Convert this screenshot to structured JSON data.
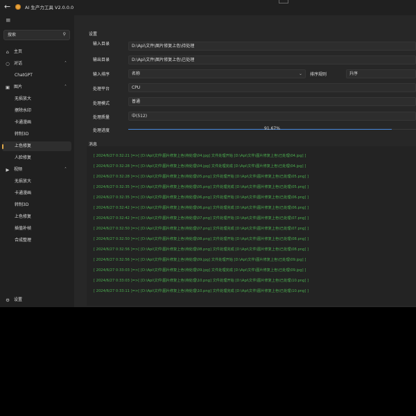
{
  "titlebar": {
    "back_icon": "back-arrow-icon",
    "title": "AI 生产力工具 V2.0.0.0"
  },
  "sidebar": {
    "menu_icon": "hamburger-icon",
    "search": {
      "placeholder": "搜索",
      "icon": "search-icon"
    },
    "items": [
      {
        "label": "主页",
        "icon": "home-icon"
      },
      {
        "label": "对话",
        "icon": "chat-icon",
        "expandable": true
      },
      {
        "label": "ChatGPT",
        "sub": true
      },
      {
        "label": "图片",
        "icon": "image-icon",
        "expandable": true
      },
      {
        "label": "无损放大",
        "sub": true
      },
      {
        "label": "擦除水印",
        "sub": true
      },
      {
        "label": "卡通漫画",
        "sub": true
      },
      {
        "label": "转制3D",
        "sub": true
      },
      {
        "label": "上色修复",
        "sub": true,
        "active": true
      },
      {
        "label": "人脸修复",
        "sub": true
      },
      {
        "label": "视频",
        "icon": "video-icon",
        "expandable": true
      },
      {
        "label": "无损放大",
        "sub": true
      },
      {
        "label": "卡通漫画",
        "sub": true
      },
      {
        "label": "转制3D",
        "sub": true
      },
      {
        "label": "上色修复",
        "sub": true
      },
      {
        "label": "插值补帧",
        "sub": true
      },
      {
        "label": "合成整理",
        "sub": true
      }
    ],
    "settings": {
      "label": "设置",
      "icon": "gear-icon"
    }
  },
  "settings_section": {
    "title": "设置",
    "input_dir": {
      "label": "输入目录",
      "value": "D:\\Api\\文件\\图片修复上色\\待处理"
    },
    "output_dir": {
      "label": "输出目录",
      "value": "D:\\Api\\文件\\图片修复上色\\已处理"
    },
    "sort": {
      "label": "输入排序",
      "value": "名称",
      "rule_label": "排序规则",
      "rule_value": "升序"
    },
    "platform": {
      "label": "处理平台",
      "value": "CPU"
    },
    "mode": {
      "label": "处理模式",
      "value": "普通"
    },
    "size": {
      "label": "处理质量",
      "value": "中(512)"
    },
    "progress": {
      "label": "处理进度",
      "value": 0.9167,
      "text": "91.67%"
    }
  },
  "messages": {
    "title": "消息",
    "color": "#4caf50",
    "lines": [
      "[ 2024/6/27 0:32:21 ]=>[ [D:\\Api\\文件\\图片修复上色\\待处理\\04.jpg] 文件处理开始 [D:\\Api\\文件\\图片修复上色\\已处理\\04.jpg] ]",
      "[ 2024/6/27 0:32:28 ]=>[ [D:\\Api\\文件\\图片修复上色\\待处理\\04.jpg] 文件处理完成 [D:\\Api\\文件\\图片修复上色\\已处理\\04.jpg] ]",
      "[ 2024/6/27 0:32:28 ]=>[ [D:\\Api\\文件\\图片修复上色\\待处理\\05.png] 文件处理开始 [D:\\Api\\文件\\图片修复上色\\已处理\\05.png] ]",
      "[ 2024/6/27 0:32:35 ]=>[ [D:\\Api\\文件\\图片修复上色\\待处理\\05.png] 文件处理完成 [D:\\Api\\文件\\图片修复上色\\已处理\\05.png] ]",
      "[ 2024/6/27 0:32:35 ]=>[ [D:\\Api\\文件\\图片修复上色\\待处理\\06.png] 文件处理开始 [D:\\Api\\文件\\图片修复上色\\已处理\\06.png] ]",
      "[ 2024/6/27 0:32:42 ]=>[ [D:\\Api\\文件\\图片修复上色\\待处理\\06.png] 文件处理完成 [D:\\Api\\文件\\图片修复上色\\已处理\\06.png] ]",
      "[ 2024/6/27 0:32:42 ]=>[ [D:\\Api\\文件\\图片修复上色\\待处理\\07.png] 文件处理开始 [D:\\Api\\文件\\图片修复上色\\已处理\\07.png] ]",
      "[ 2024/6/27 0:32:50 ]=>[ [D:\\Api\\文件\\图片修复上色\\待处理\\07.png] 文件处理完成 [D:\\Api\\文件\\图片修复上色\\已处理\\07.png] ]",
      "[ 2024/6/27 0:32:50 ]=>[ [D:\\Api\\文件\\图片修复上色\\待处理\\08.png] 文件处理开始 [D:\\Api\\文件\\图片修复上色\\已处理\\08.png] ]",
      "[ 2024/6/27 0:32:56 ]=>[ [D:\\Api\\文件\\图片修复上色\\待处理\\08.png] 文件处理完成 [D:\\Api\\文件\\图片修复上色\\已处理\\08.png] ]",
      "[ 2024/6/27 0:32:56 ]=>[ [D:\\Api\\文件\\图片修复上色\\待处理\\09.jpg] 文件处理开始 [D:\\Api\\文件\\图片修复上色\\已处理\\09.jpg] ]",
      "[ 2024/6/27 0:33:03 ]=>[ [D:\\Api\\文件\\图片修复上色\\待处理\\09.jpg] 文件处理完成 [D:\\Api\\文件\\图片修复上色\\已处理\\09.jpg] ]",
      "[ 2024/6/27 0:33:03 ]=>[ [D:\\Api\\文件\\图片修复上色\\待处理\\10.png] 文件处理开始 [D:\\Api\\文件\\图片修复上色\\已处理\\10.png] ]",
      "[ 2024/6/27 0:33:11 ]=>[ [D:\\Api\\文件\\图片修复上色\\待处理\\10.png] 文件处理完成 [D:\\Api\\文件\\图片修复上色\\已处理\\10.png] ]"
    ]
  }
}
